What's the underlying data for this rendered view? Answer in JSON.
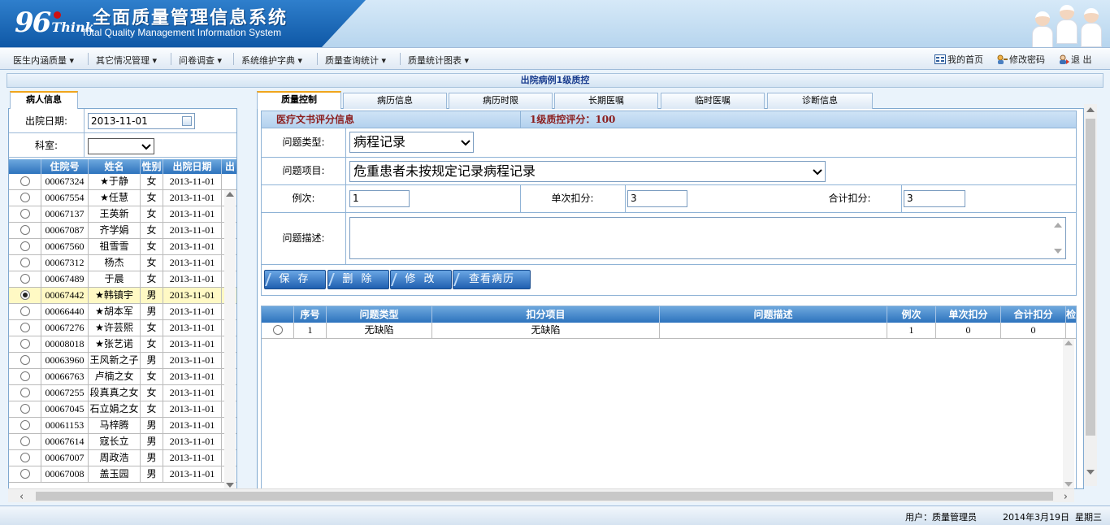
{
  "header": {
    "logo_number": "96",
    "logo_word": "Think",
    "title": "全面质量管理信息系统",
    "subtitle": "Total Quality Management Information System"
  },
  "menu": {
    "items": [
      {
        "label": "医生内涵质量"
      },
      {
        "label": "其它情况管理"
      },
      {
        "label": "问卷调查"
      },
      {
        "label": "系统维护字典"
      },
      {
        "label": "质量查询统计"
      },
      {
        "label": "质量统计图表"
      }
    ],
    "home": "我的首页",
    "change_password": "修改密码",
    "logout": "退 出"
  },
  "page_title": "出院病例1级质控",
  "left": {
    "tab": "病人信息",
    "discharge_date_label": "出院日期:",
    "discharge_date_value": "2013-11-01",
    "dept_label": "科室:",
    "dept_value": "",
    "columns": [
      "",
      "住院号",
      "姓名",
      "性别",
      "出院日期",
      "出"
    ],
    "rows": [
      {
        "id": "00067324",
        "name": "★于静",
        "sex": "女",
        "date": "2013-11-01"
      },
      {
        "id": "00067554",
        "name": "★任慧",
        "sex": "女",
        "date": "2013-11-01"
      },
      {
        "id": "00067137",
        "name": "王英新",
        "sex": "女",
        "date": "2013-11-01"
      },
      {
        "id": "00067087",
        "name": "齐学娟",
        "sex": "女",
        "date": "2013-11-01"
      },
      {
        "id": "00067560",
        "name": "祖雪雪",
        "sex": "女",
        "date": "2013-11-01"
      },
      {
        "id": "00067312",
        "name": "杨杰",
        "sex": "女",
        "date": "2013-11-01"
      },
      {
        "id": "00067489",
        "name": "于晨",
        "sex": "女",
        "date": "2013-11-01"
      },
      {
        "id": "00067442",
        "name": "★韩镇宇",
        "sex": "男",
        "date": "2013-11-01",
        "selected": true
      },
      {
        "id": "00066440",
        "name": "★胡本军",
        "sex": "男",
        "date": "2013-11-01"
      },
      {
        "id": "00067276",
        "name": "★许芸熙",
        "sex": "女",
        "date": "2013-11-01"
      },
      {
        "id": "00008018",
        "name": "★张艺诺",
        "sex": "女",
        "date": "2013-11-01"
      },
      {
        "id": "00063960",
        "name": "王风新之子",
        "sex": "男",
        "date": "2013-11-01"
      },
      {
        "id": "00066763",
        "name": "卢楠之女",
        "sex": "女",
        "date": "2013-11-01"
      },
      {
        "id": "00067255",
        "name": "段真真之女",
        "sex": "女",
        "date": "2013-11-01"
      },
      {
        "id": "00067045",
        "name": "石立娟之女",
        "sex": "女",
        "date": "2013-11-01"
      },
      {
        "id": "00061153",
        "name": "马梓腾",
        "sex": "男",
        "date": "2013-11-01"
      },
      {
        "id": "00067614",
        "name": "寇长立",
        "sex": "男",
        "date": "2013-11-01"
      },
      {
        "id": "00067007",
        "name": "周政浩",
        "sex": "男",
        "date": "2013-11-01"
      },
      {
        "id": "00067008",
        "name": "盖玉园",
        "sex": "男",
        "date": "2013-11-01"
      }
    ]
  },
  "right": {
    "tabs": [
      "质量控制",
      "病历信息",
      "病历时限",
      "长期医嘱",
      "临时医嘱",
      "诊断信息"
    ],
    "section_title": "医疗文书评分信息",
    "score_label": "1级质控评分：100",
    "form": {
      "problem_type_label": "问题类型:",
      "problem_type_value": "病程记录",
      "problem_item_label": "问题项目:",
      "problem_item_value": "危重患者未按规定记录病程记录",
      "count_label": "例次:",
      "count_value": "1",
      "single_deduct_label": "单次扣分:",
      "single_deduct_value": "3",
      "total_deduct_label": "合计扣分:",
      "total_deduct_value": "3",
      "description_label": "问题描述:",
      "description_value": ""
    },
    "buttons": {
      "save": "保 存",
      "delete": "删 除",
      "modify": "修 改",
      "view_record": "查看病历"
    },
    "table": {
      "columns": [
        "",
        "序号",
        "问题类型",
        "扣分项目",
        "问题描述",
        "例次",
        "单次扣分",
        "合计扣分",
        "检"
      ],
      "rows": [
        {
          "no": "1",
          "type": "无缺陷",
          "item": "无缺陷",
          "desc": "",
          "count": "1",
          "single": "0",
          "total": "0"
        }
      ]
    }
  },
  "status": {
    "user": "用户：质量管理员",
    "date": "2014年3月19日  星期三"
  },
  "colors": {
    "accent": "#2d73bd",
    "score_text": "#8b1e1e",
    "tab_highlight": "#f0a51d",
    "selected_row": "#fff9c4"
  }
}
